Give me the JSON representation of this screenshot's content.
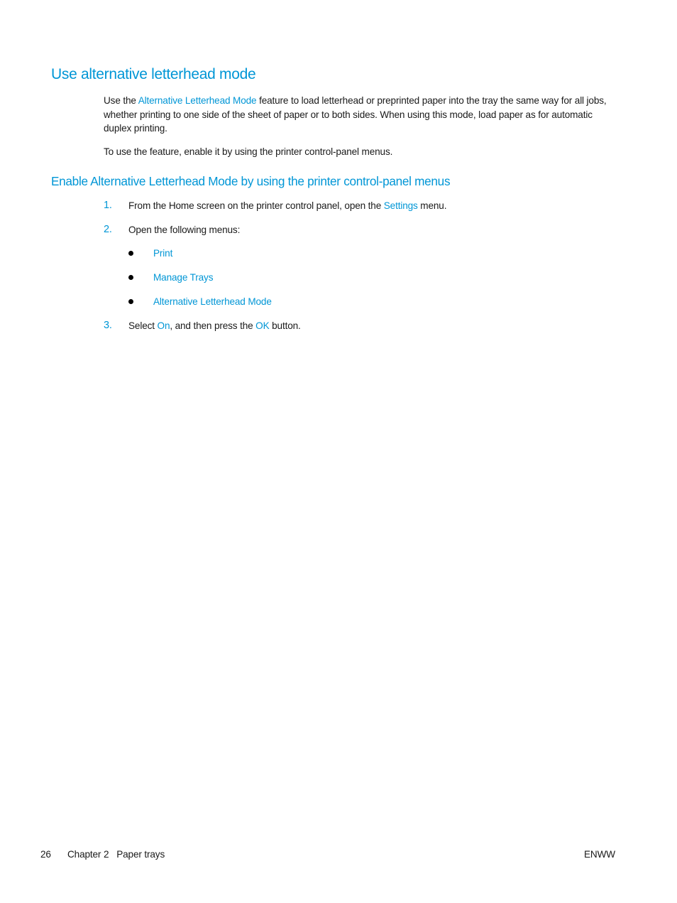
{
  "section": {
    "title": "Use alternative letterhead mode",
    "intro": {
      "before_link": "Use the ",
      "link": "Alternative Letterhead Mode",
      "after_link": " feature to load letterhead or preprinted paper into the tray the same way for all jobs, whether printing to one side of the sheet of paper or to both sides. When using this mode, load paper as for automatic duplex printing."
    },
    "note": "To use the feature, enable it by using the printer control-panel menus."
  },
  "subsection": {
    "title": "Enable Alternative Letterhead Mode by using the printer control-panel menus",
    "steps": [
      {
        "number": "1.",
        "before": "From the Home screen on the printer control panel, open the ",
        "link": "Settings",
        "after": " menu."
      },
      {
        "number": "2.",
        "text": "Open the following menus:",
        "menus": [
          "Print",
          "Manage Trays",
          "Alternative Letterhead Mode"
        ]
      },
      {
        "number": "3.",
        "before": "Select ",
        "link1": "On",
        "middle": ", and then press the ",
        "link2": "OK",
        "after": " button."
      }
    ]
  },
  "footer": {
    "page_number": "26",
    "chapter": "Chapter 2   Paper trays",
    "right": "ENWW"
  },
  "colors": {
    "accent": "#0096d6",
    "text": "#1a1a1a"
  }
}
